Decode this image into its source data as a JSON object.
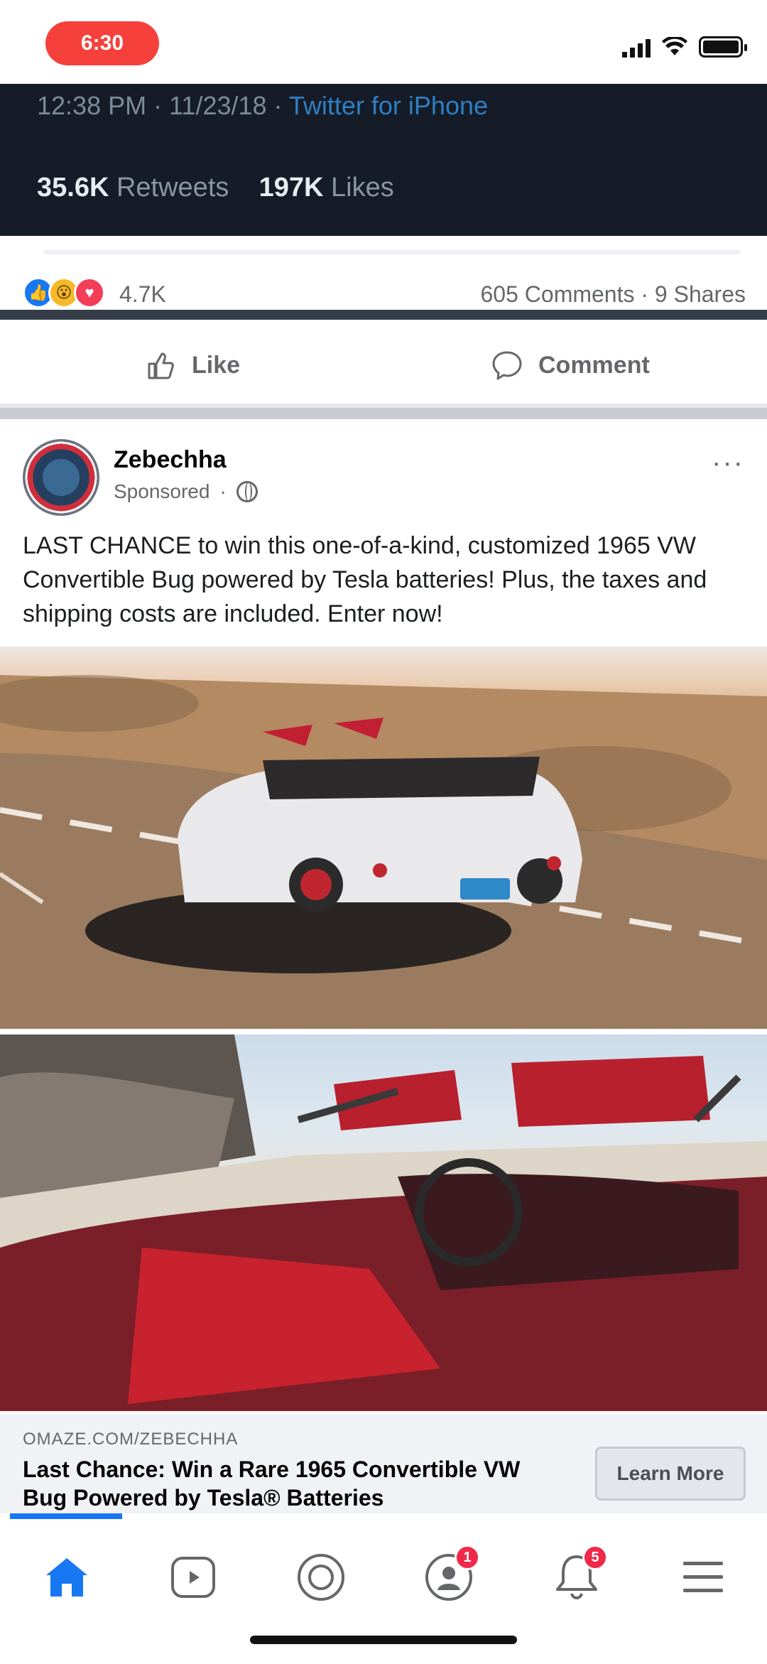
{
  "status_bar": {
    "time": "6:30"
  },
  "tweet": {
    "meta_time": "12:38 PM · 11/23/18 · ",
    "meta_link": "Twitter for iPhone",
    "retweets_count": "35.6K",
    "retweets_label": "Retweets",
    "likes_count": "197K",
    "likes_label": "Likes"
  },
  "reactions": {
    "count": "4.7K",
    "comments_shares": "605 Comments · 9 Shares"
  },
  "actions": {
    "like_label": "Like",
    "comment_label": "Comment"
  },
  "post": {
    "page_name": "Zebechha",
    "sponsored_label": "Sponsored",
    "more": "···",
    "text": "LAST CHANCE to win this one-of-a-kind, customized 1965 VW Convertible Bug powered by Tesla batteries! Plus, the taxes and shipping costs are included. Enter now!"
  },
  "ad": {
    "domain": "OMAZE.COM/ZEBECHHA",
    "headline": "Last Chance: Win a Rare 1965 Convertible VW Bug Powered by Tesla® Batteries",
    "cta": "Learn More"
  },
  "nav": {
    "watch_badge": "1",
    "notifications_badge": "5",
    "items": [
      "home-icon",
      "watch-icon",
      "marketplace-icon",
      "groups-icon",
      "notifications-icon",
      "menu-icon"
    ]
  },
  "colors": {
    "accent": "#1877f2",
    "badge": "#f02849",
    "time_pill": "#f5403b"
  }
}
